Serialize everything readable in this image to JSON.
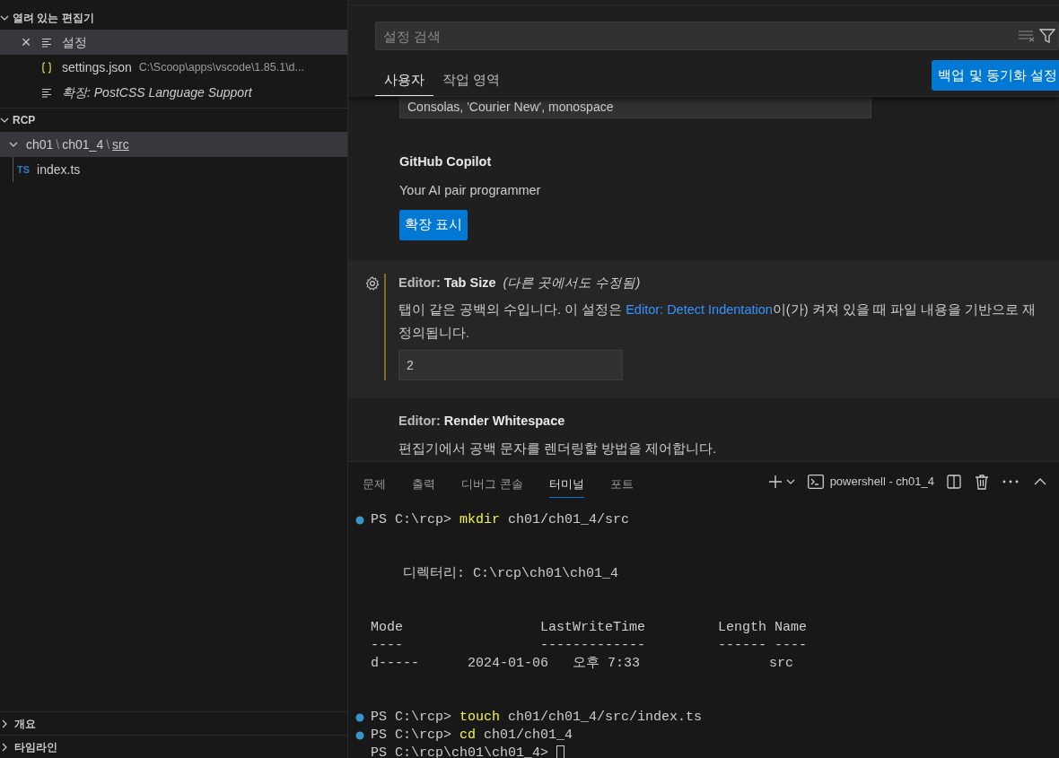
{
  "sidebar": {
    "open_editors": {
      "title": "열려 있는 편집기",
      "expanded": true,
      "items": [
        {
          "label": "설정",
          "kind": "page",
          "selected": true,
          "italic": false,
          "close": "×"
        },
        {
          "label": "settings.json",
          "description": "C:\\Scoop\\apps\\vscode\\1.85.1\\d...",
          "kind": "file",
          "selected": false,
          "italic": false
        },
        {
          "label": "확장: PostCSS Language Support",
          "kind": "page",
          "selected": false,
          "italic": true
        }
      ]
    },
    "folder": {
      "title": "RCP",
      "expanded": true,
      "tree": [
        {
          "segments": [
            "ch01",
            "ch01_4",
            "src"
          ],
          "separator": "\\",
          "expanded": true,
          "selected": true,
          "children": [
            {
              "label": "index.ts",
              "badge": "TS",
              "selected": false
            }
          ]
        }
      ]
    },
    "bottom_sections": [
      {
        "title": "개요",
        "expanded": false
      },
      {
        "title": "타임라인",
        "expanded": false
      }
    ]
  },
  "settings": {
    "search": {
      "placeholder": "설정 검색"
    },
    "tabs": [
      {
        "label": "사용자",
        "selected": true
      },
      {
        "label": "작업 영역",
        "selected": false
      }
    ],
    "sync_button": "백업 및 동기화 설정",
    "items": [
      {
        "kind": "value",
        "value": "Consolas, 'Courier New', monospace"
      },
      {
        "kind": "extension",
        "title": "GitHub Copilot",
        "description": "Your AI pair programmer",
        "button": "확장 표시"
      },
      {
        "kind": "setting",
        "focused": true,
        "category": "Editor: ",
        "name": "Tab Size",
        "modified": "(다른 곳에서도 수정됨)",
        "description": [
          {
            "text": "탭이 같은 공백의 수입니다. 이 설정은 "
          },
          {
            "link": "Editor: Detect Indentation"
          },
          {
            "text": "이(가) 켜져 있을 때 파일 내용을 기반으로 재정의됩니다."
          }
        ],
        "value": "2"
      },
      {
        "kind": "setting",
        "focused": false,
        "category": "Editor: ",
        "name": "Render Whitespace",
        "description": [
          {
            "text": "편집기에서 공백 문자를 렌더링할 방법을 제어합니다."
          }
        ]
      }
    ]
  },
  "panel": {
    "tabs": [
      {
        "label": "문제",
        "selected": false
      },
      {
        "label": "출력",
        "selected": false
      },
      {
        "label": "디버그 콘솔",
        "selected": false
      },
      {
        "label": "터미널",
        "selected": true
      },
      {
        "label": "포트",
        "selected": false
      }
    ],
    "terminal_name": "powershell - ch01_4",
    "lines": [
      {
        "kind": "prompt",
        "prompt": "PS C:\\rcp> ",
        "command": "mkdir",
        "args": " ch01/ch01_4/src"
      },
      {
        "kind": "blank"
      },
      {
        "kind": "blank"
      },
      {
        "kind": "output",
        "text": "    디렉터리: C:\\rcp\\ch01\\ch01_4"
      },
      {
        "kind": "blank"
      },
      {
        "kind": "blank"
      },
      {
        "kind": "output",
        "text": "Mode                 LastWriteTime         Length Name"
      },
      {
        "kind": "output",
        "text": "----                 -------------         ------ ----"
      },
      {
        "kind": "output",
        "text": "d-----      2024-01-06   오후 7:33                src"
      },
      {
        "kind": "blank"
      },
      {
        "kind": "blank"
      },
      {
        "kind": "prompt",
        "prompt": "PS C:\\rcp> ",
        "command": "touch",
        "args": " ch01/ch01_4/src/index.ts"
      },
      {
        "kind": "prompt",
        "prompt": "PS C:\\rcp> ",
        "command": "cd",
        "args": " ch01/ch01_4"
      },
      {
        "kind": "current",
        "prompt": "PS C:\\rcp\\ch01\\ch01_4> ",
        "cursor": true
      }
    ]
  }
}
